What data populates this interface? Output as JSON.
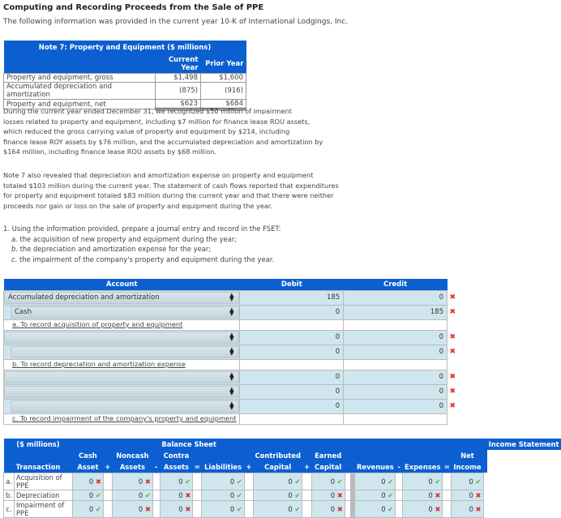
{
  "header": {
    "title": "Computing and Recording Proceeds from the Sale of PPE",
    "intro": "The following information was provided in the current year 10-K of International Lodgings, Inc."
  },
  "note7": {
    "title": "Note 7: Property and Equipment ($ millions)",
    "columns": [
      "Current Year",
      "Prior Year"
    ],
    "rows": [
      {
        "label": "Property and equipment, gross",
        "current": "$1,498",
        "prior": "$1,600"
      },
      {
        "label": "Accumulated depreciation and amortization",
        "current": "(875)",
        "prior": "(916)"
      },
      {
        "label": "Property and equipment, net",
        "current": "$623",
        "prior": "$684"
      }
    ]
  },
  "paragraphs": {
    "p1": [
      "During the current year ended December 31, we recognized $50 million of impairment",
      "losses related to property and equipment, including $7 million for finance lease ROU assets,",
      "which reduced the gross carrying value of property and equipment by $214, including",
      "finance lease ROY assets by $76 million, and the accumulated depreciation and amortization by",
      "$164 million, including finance lease ROU assets by $68 million."
    ],
    "p2": [
      "Note 7 also revealed that depreciation and amortization expense on property and equipment",
      "totaled $103 million during the current year. The statement of cash flows reported that expenditures",
      "for property and equipment totaled $83 million during the current year and that there were neither",
      "proceeds nor gain or loss on the sale of property and equipment during the year."
    ]
  },
  "question": {
    "main": "1. Using the information provided, prepare a journal entry and record in the FSET:",
    "items": [
      {
        "letter": "a.",
        "text": " the acquisition of new property and equipment during the year;"
      },
      {
        "letter": "b.",
        "text": " the depreciation and amortization expense for the year;"
      },
      {
        "letter": "c.",
        "text": " the impairment of the company's property and equipment during the year."
      }
    ]
  },
  "journal": {
    "headers": {
      "account": "Account",
      "debit": "Debit",
      "credit": "Credit"
    },
    "entries": [
      {
        "lines": [
          {
            "account": "Accumulated depreciation and amortization",
            "indent": false,
            "debit": "185",
            "credit": "0",
            "status": "x"
          },
          {
            "account": "Cash",
            "indent": true,
            "debit": "0",
            "credit": "185",
            "status": "x"
          }
        ],
        "description": "a. To record acquisition of property and equipment"
      },
      {
        "lines": [
          {
            "account": "",
            "indent": false,
            "debit": "0",
            "credit": "0",
            "status": "x"
          },
          {
            "account": "",
            "indent": true,
            "debit": "0",
            "credit": "0",
            "status": "x"
          }
        ],
        "description": "b. To record depreciation and amortization expense"
      },
      {
        "lines": [
          {
            "account": "",
            "indent": false,
            "debit": "0",
            "credit": "0",
            "status": "x"
          },
          {
            "account": "",
            "indent": false,
            "debit": "0",
            "credit": "0",
            "status": "x"
          },
          {
            "account": "",
            "indent": true,
            "debit": "0",
            "credit": "0",
            "status": "x"
          }
        ],
        "description": "c. To record impairment of the company's property and equipment"
      }
    ]
  },
  "fset": {
    "units": "($ millions)",
    "balance_sheet_label": "Balance Sheet",
    "income_statement_label": "Income Statement",
    "transaction_label": "Transaction",
    "columns": [
      {
        "line1": "Cash",
        "line2": "Asset",
        "op": "+"
      },
      {
        "line1": "Noncash",
        "line2": "Assets",
        "op": "-"
      },
      {
        "line1": "Contra",
        "line2": "Assets",
        "op": "="
      },
      {
        "line1": "",
        "line2": "Liabilities",
        "op": "+"
      },
      {
        "line1": "Contributed",
        "line2": "Capital",
        "op": "+"
      },
      {
        "line1": "Earned",
        "line2": "Capital",
        "op": ""
      },
      {
        "line1": "",
        "line2": "Revenues",
        "op": "-"
      },
      {
        "line1": "",
        "line2": "Expenses",
        "op": "="
      },
      {
        "line1": "Net",
        "line2": "Income",
        "op": ""
      }
    ],
    "rows": [
      {
        "letter": "a.",
        "label": "Acquisition of PPE",
        "values": [
          "0",
          "0",
          "0",
          "0",
          "0",
          "0",
          "0",
          "0",
          "0"
        ],
        "status": [
          "x",
          "x",
          "ok",
          "ok",
          "ok",
          "ok",
          "ok",
          "ok",
          "ok"
        ]
      },
      {
        "letter": "b.",
        "label": "Depreciation",
        "values": [
          "0",
          "0",
          "0",
          "0",
          "0",
          "0",
          "0",
          "0",
          "0"
        ],
        "status": [
          "ok",
          "ok",
          "x",
          "ok",
          "ok",
          "x",
          "ok",
          "x",
          "x"
        ]
      },
      {
        "letter": "c.",
        "label": "Impairment of PPE",
        "values": [
          "0",
          "0",
          "0",
          "0",
          "0",
          "0",
          "0",
          "0",
          "0"
        ],
        "status": [
          "ok",
          "x",
          "x",
          "ok",
          "ok",
          "x",
          "ok",
          "x",
          "x"
        ]
      }
    ]
  },
  "icons": {
    "correct": "✔",
    "incorrect": "✖",
    "select_arrows": "⇕"
  },
  "colors": {
    "header_blue": "#0b5fd0",
    "input_bg": "#cfe6ee",
    "error_red": "#e03030",
    "ok_green": "#4caf50"
  }
}
